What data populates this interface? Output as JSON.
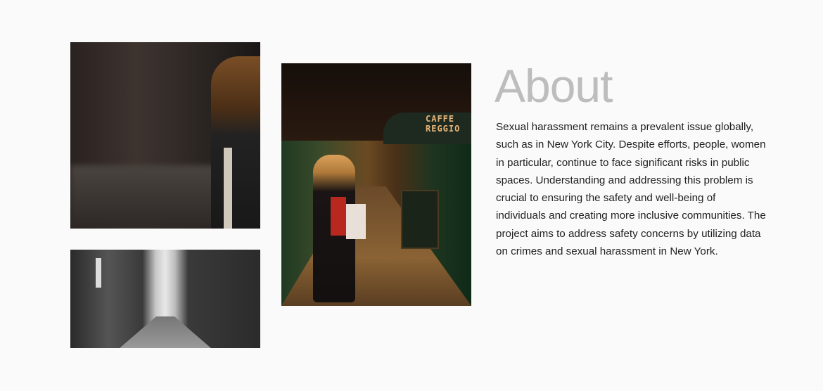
{
  "about": {
    "heading": "About",
    "paragraph_lines": [
      "Sexual harassment remains a prevalent issue globally,",
      "such as in New York City. Despite efforts, people, women",
      "in particular, continue to face significant risks in public",
      "spaces. Understanding and addressing this problem is",
      "crucial to ensuring the safety and well-being of",
      "individuals and creating more inclusive communities. The",
      "project aims to address safety concerns by utilizing data",
      "on crimes and sexual harassment in New York."
    ]
  },
  "photos": {
    "cafe_sign": [
      "CAFFE",
      "REGGIO"
    ]
  }
}
